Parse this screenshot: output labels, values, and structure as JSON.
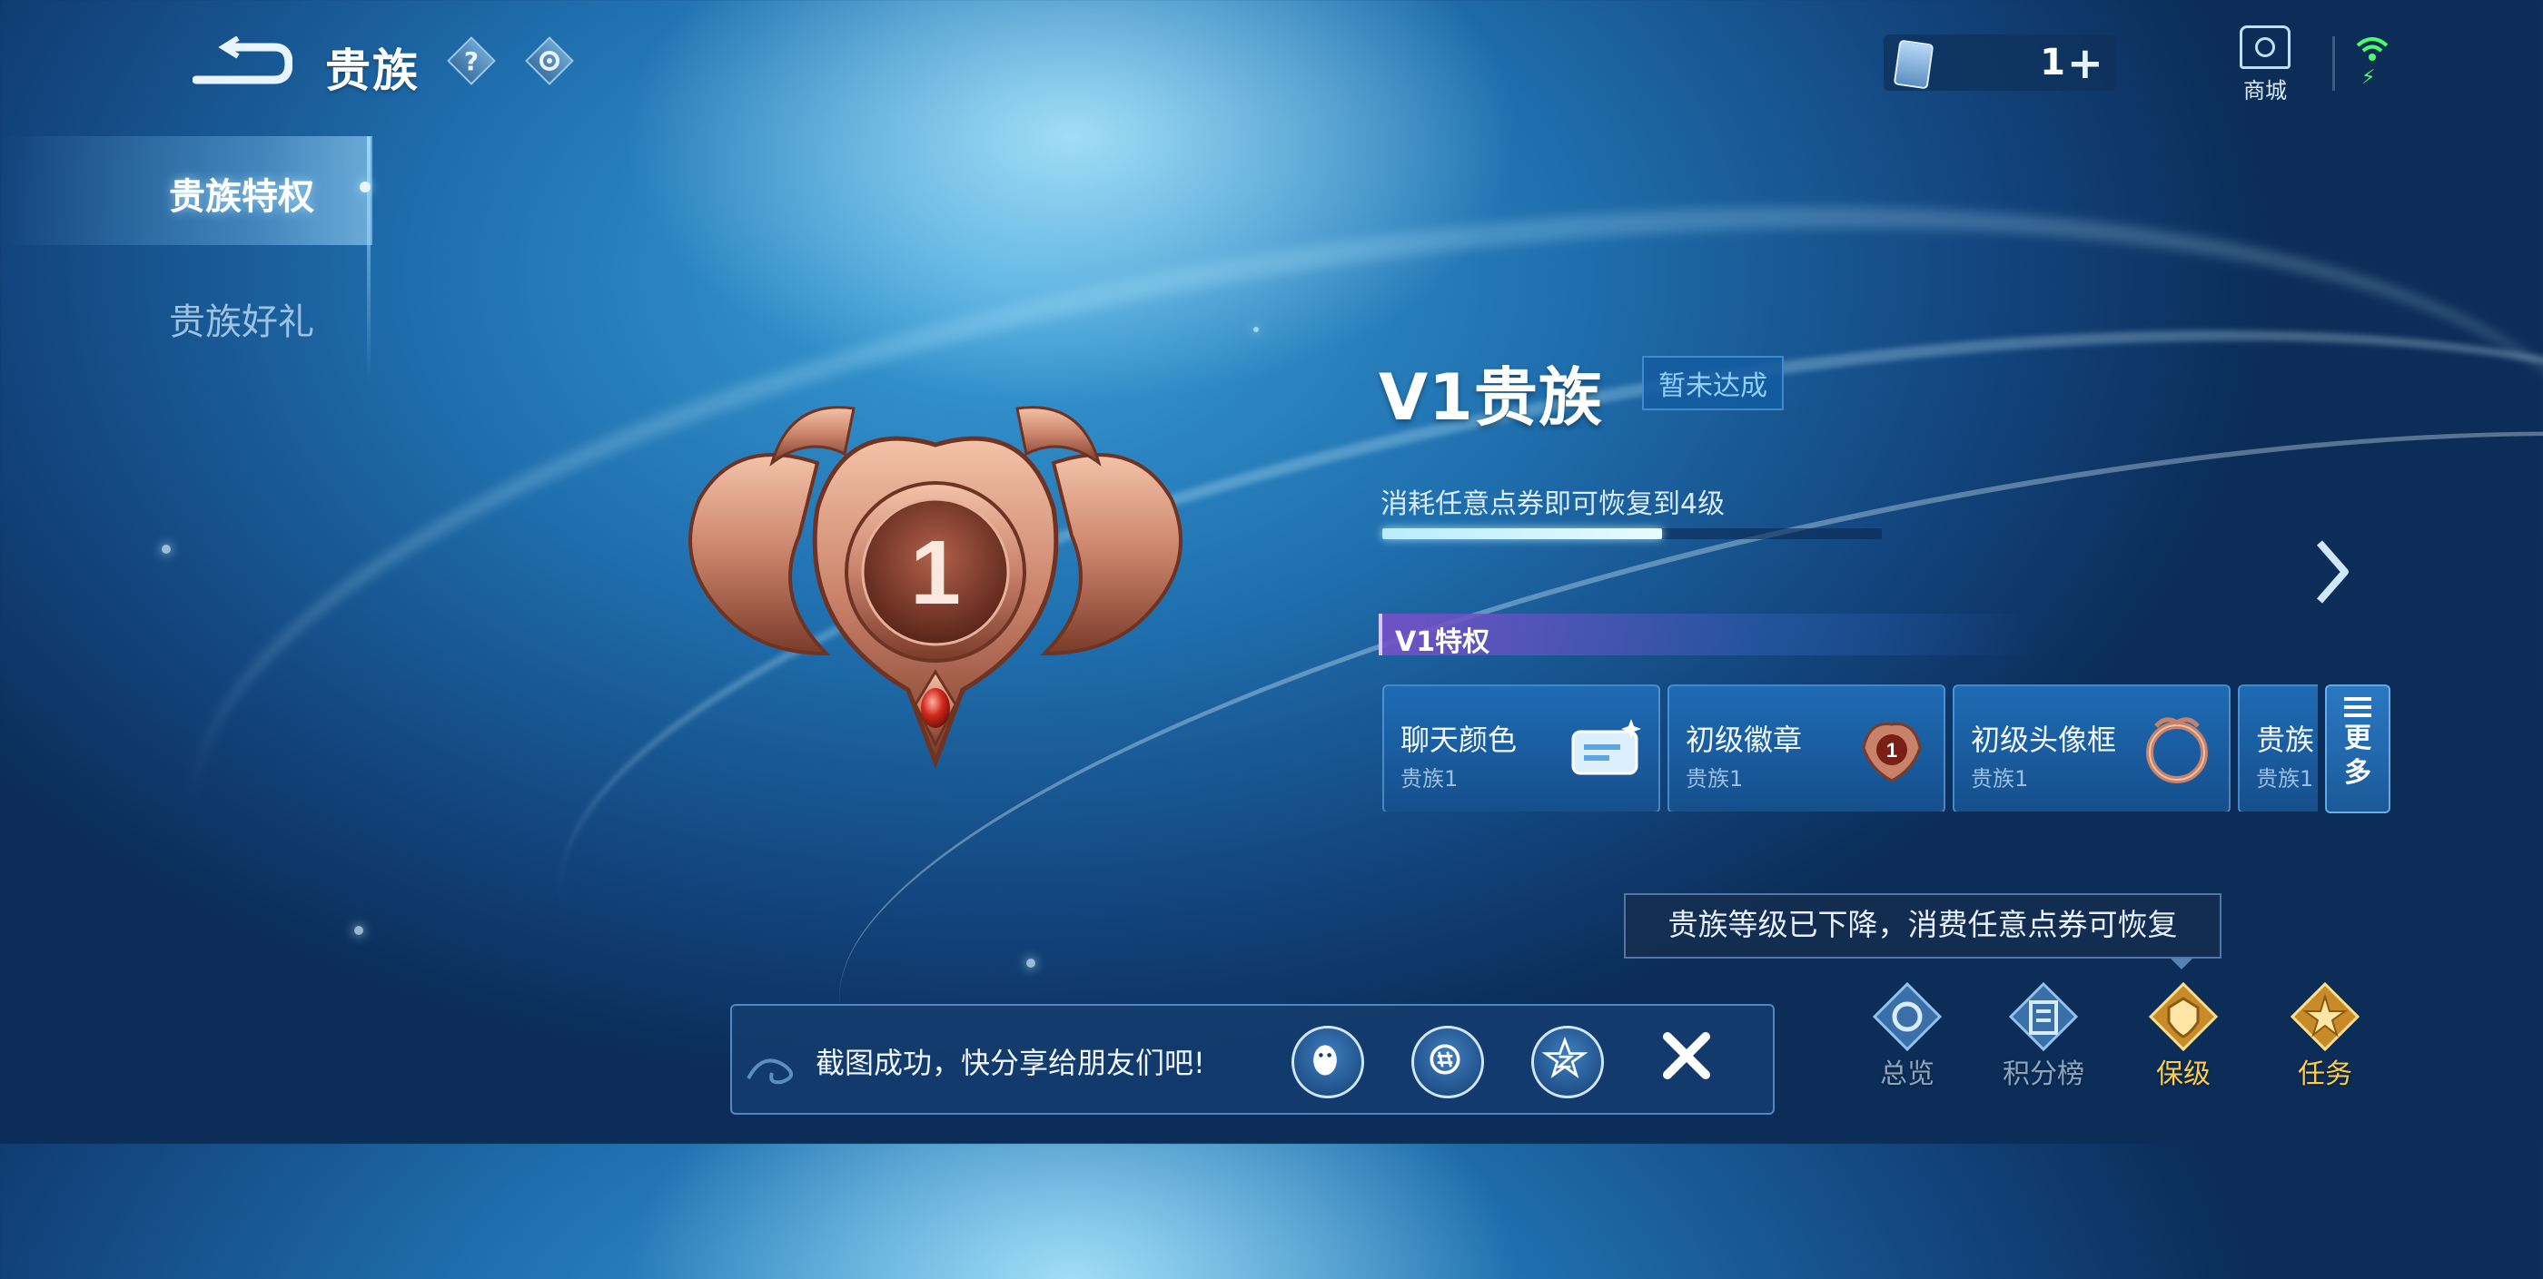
{
  "header": {
    "title": "贵族",
    "help_icon_glyph": "?",
    "ticket_count": "1",
    "ticket_plus": "+",
    "shop_label": "商城"
  },
  "sidebar": {
    "items": [
      {
        "label": "贵族特权",
        "active": true
      },
      {
        "label": "贵族好礼",
        "active": false
      }
    ]
  },
  "emblem": {
    "level": "1"
  },
  "vip": {
    "title": "V1贵族",
    "status": "暂未达成",
    "progress_text": "消耗任意点券即可恢复到4级",
    "progress": 0.56
  },
  "privileges": {
    "header": "V1特权",
    "cards": [
      {
        "name": "聊天颜色",
        "level": "贵族1",
        "icon": "chat-bubble-icon"
      },
      {
        "name": "初级徽章",
        "level": "贵族1",
        "icon": "badge-icon"
      },
      {
        "name": "初级头像框",
        "level": "贵族1",
        "icon": "avatar-frame-icon"
      },
      {
        "name": "贵族",
        "level": "贵族1",
        "icon": "partial-card"
      }
    ],
    "more_label": "更多"
  },
  "tooltip": "贵族等级已下降，消费任意点券可恢复",
  "bottom_nav": [
    {
      "label": "总览",
      "icon": "overview-icon"
    },
    {
      "label": "积分榜",
      "icon": "leaderboard-icon"
    },
    {
      "label": "保级",
      "icon": "keep-level-icon"
    },
    {
      "label": "任务",
      "icon": "tasks-icon"
    }
  ],
  "share": {
    "text": "截图成功，快分享给朋友们吧!",
    "targets": [
      "qq-icon",
      "wechat-moments-icon",
      "qzone-icon"
    ],
    "close_icon": "close-icon"
  },
  "colors": {
    "accent_gold": "#ffcc4a",
    "wifi_green": "#4cff6a",
    "bronze": "#c9826a"
  }
}
